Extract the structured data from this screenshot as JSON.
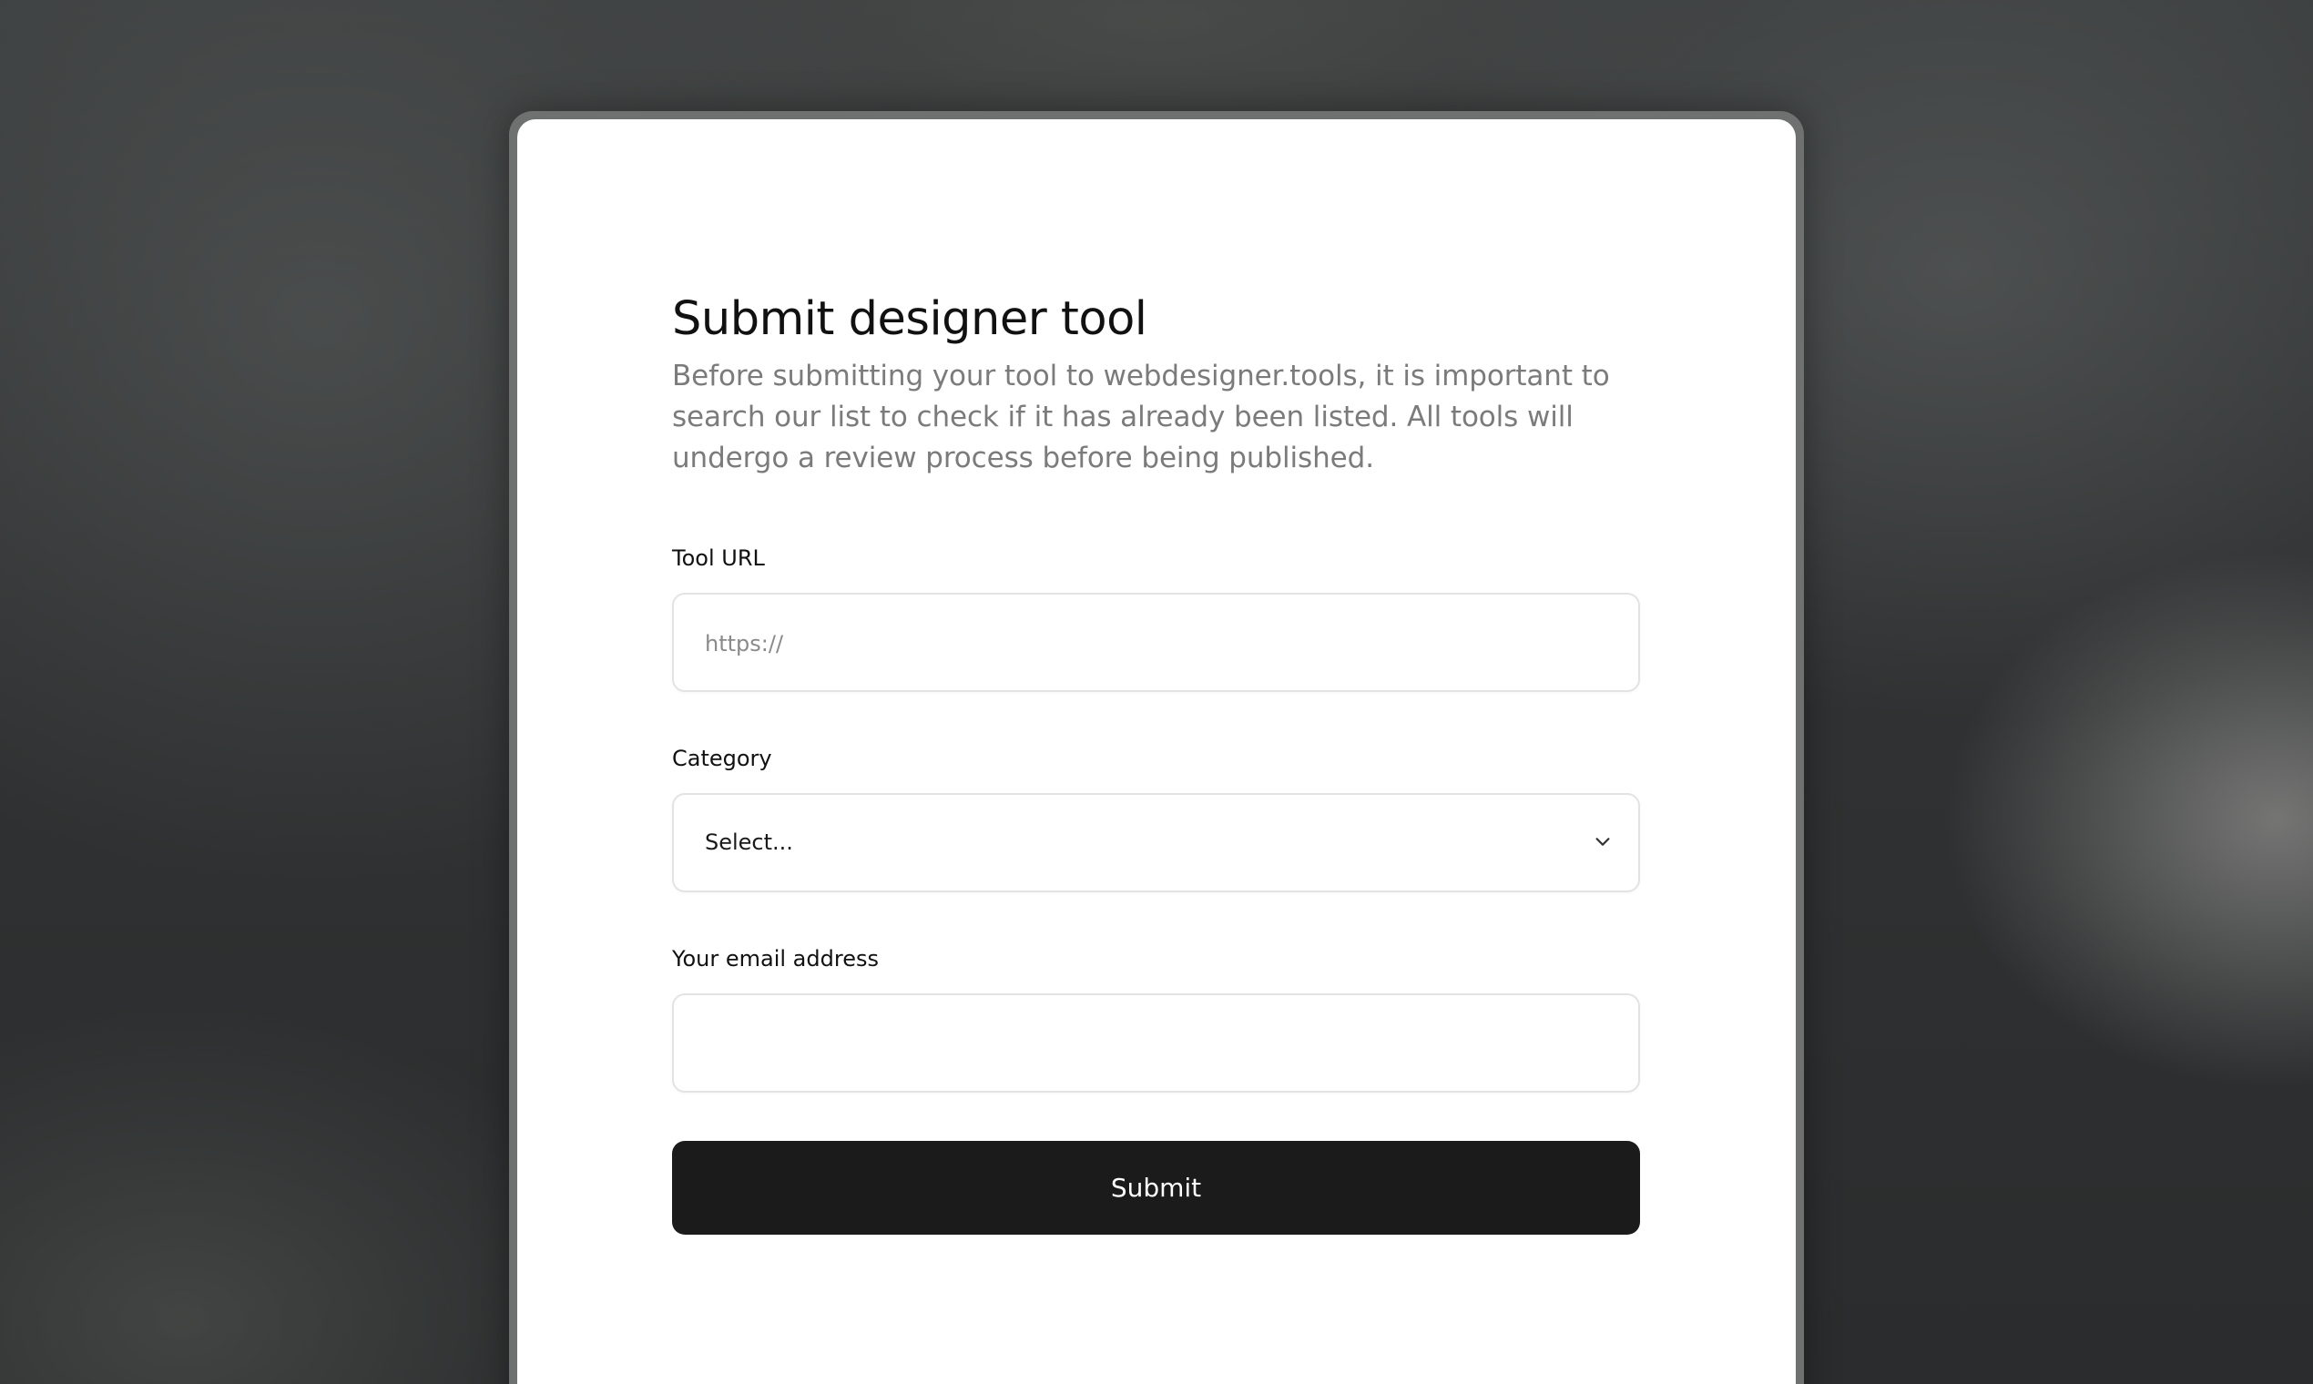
{
  "form": {
    "title": "Submit designer tool",
    "description": "Before submitting your tool to webdesigner.tools, it is important to search our list to check if it has already been listed. All tools will undergo a review process before being published.",
    "tool_url": {
      "label": "Tool URL",
      "placeholder": "https://",
      "value": ""
    },
    "category": {
      "label": "Category",
      "selected": "Select..."
    },
    "email": {
      "label": "Your email address",
      "placeholder": "",
      "value": ""
    },
    "submit_label": "Submit"
  },
  "icons": {
    "select_indicator": "chevron-down-icon"
  },
  "colors": {
    "button_background": "#1b1b1b",
    "button_text": "#ffffff",
    "description_text": "#7b7b7b",
    "input_border": "#e3e3e3"
  }
}
